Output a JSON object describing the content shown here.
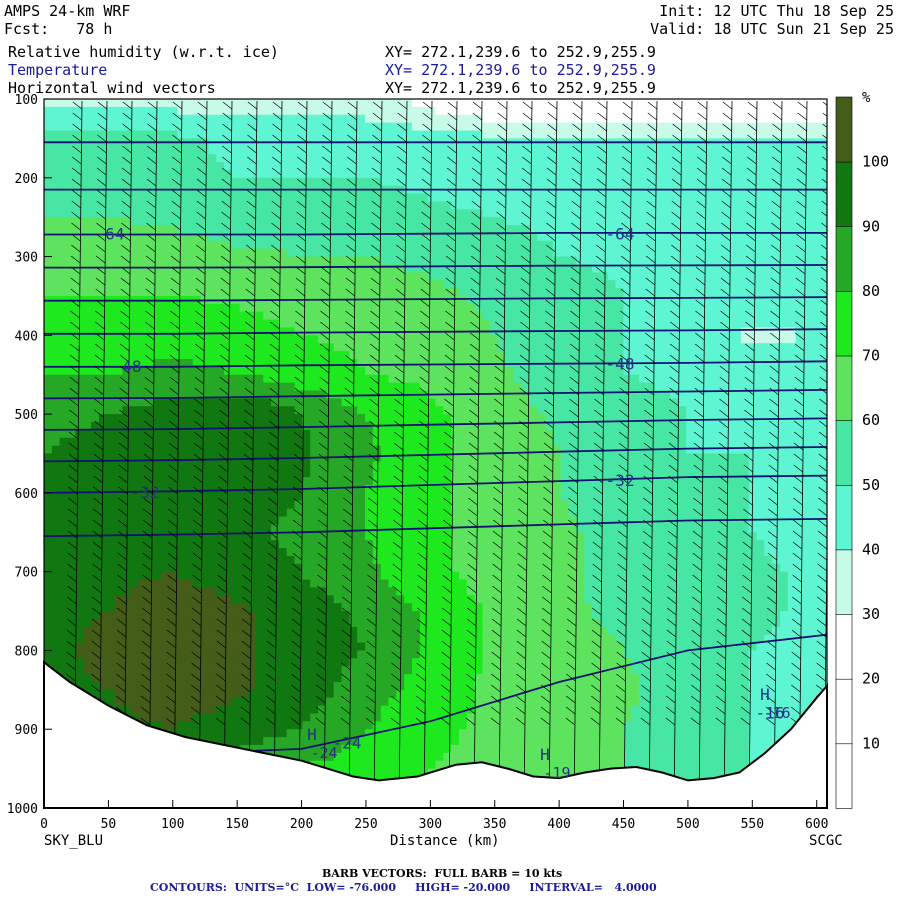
{
  "header": {
    "model": "AMPS 24-km WRF",
    "fcst": "Fcst:   78 h",
    "init": "Init: 12 UTC Thu 18 Sep 25",
    "valid": "Valid: 18 UTC Sun 21 Sep 25",
    "field1": "Relative humidity (w.r.t. ice)",
    "field2": "Temperature",
    "field3": "Horizontal wind vectors",
    "xy1": "XY= 272.1,239.6 to 252.9,255.9",
    "xy2": "XY= 272.1,239.6 to 252.9,255.9",
    "xy3": "XY= 272.1,239.6 to 252.9,255.9"
  },
  "axes": {
    "xlabel": "Distance (km)",
    "left_end": "SKY_BLU",
    "right_end": "SCGC",
    "colorbar_unit": "%"
  },
  "footer": {
    "barb": "BARB VECTORS:  FULL BARB = 10 kts",
    "contours": "CONTOURS:  UNITS=°C  LOW= -76.000     HIGH= -20.000     INTERVAL=   4.0000"
  },
  "colors": {
    "rh_0_10": "#ffffff",
    "rh_10_20": "#ffffff",
    "rh_20_30": "#ffffff",
    "rh_30_40": "#c8fae8",
    "rh_40_50": "#5ef5d2",
    "rh_50_60": "#47e6a4",
    "rh_60_70": "#5ee35e",
    "rh_70_80": "#1ee91e",
    "rh_80_90": "#26a826",
    "rh_90_100": "#117811",
    "rh_100": "#445d19",
    "contour": "#101075"
  },
  "chart_data": {
    "type": "heatmap",
    "xlabel": "Distance (km)",
    "ylabel": "",
    "x_ticks": [
      "0",
      "50",
      "100",
      "150",
      "200",
      "250",
      "300",
      "350",
      "400",
      "450",
      "500",
      "550",
      "600"
    ],
    "xlim": [
      0,
      608
    ],
    "y_ticks": [
      "100",
      "200",
      "300",
      "400",
      "500",
      "600",
      "700",
      "800",
      "900",
      "1000"
    ],
    "ylim": [
      1000,
      100
    ],
    "colorbar": {
      "unit": "%",
      "levels": [
        "10",
        "20",
        "30",
        "40",
        "50",
        "60",
        "70",
        "80",
        "90",
        "100"
      ],
      "bounds": [
        0,
        10,
        20,
        30,
        40,
        50,
        60,
        70,
        80,
        90,
        100,
        110
      ]
    },
    "rh_field": {
      "x": [
        0,
        50,
        100,
        150,
        200,
        250,
        300,
        350,
        400,
        450,
        500,
        550,
        600
      ],
      "pressure": [
        100,
        150,
        200,
        250,
        300,
        350,
        400,
        450,
        500,
        550,
        600,
        650,
        700,
        750,
        800,
        850,
        900,
        950
      ],
      "values": [
        [
          35,
          35,
          35,
          35,
          35,
          35,
          25,
          15,
          15,
          15,
          15,
          15,
          15
        ],
        [
          52,
          52,
          52,
          48,
          45,
          45,
          45,
          42,
          42,
          42,
          42,
          40,
          40
        ],
        [
          55,
          55,
          52,
          50,
          50,
          50,
          48,
          45,
          45,
          45,
          45,
          45,
          45
        ],
        [
          60,
          60,
          58,
          55,
          55,
          55,
          52,
          50,
          48,
          48,
          48,
          48,
          48
        ],
        [
          65,
          65,
          65,
          62,
          60,
          60,
          58,
          55,
          50,
          48,
          48,
          45,
          45
        ],
        [
          70,
          70,
          70,
          68,
          65,
          65,
          62,
          58,
          55,
          50,
          45,
          45,
          45
        ],
        [
          75,
          75,
          78,
          75,
          70,
          68,
          65,
          60,
          55,
          50,
          45,
          38,
          40
        ],
        [
          80,
          80,
          82,
          80,
          75,
          70,
          68,
          62,
          55,
          50,
          48,
          45,
          45
        ],
        [
          85,
          90,
          95,
          100,
          90,
          80,
          72,
          65,
          58,
          55,
          50,
          48,
          45
        ],
        [
          90,
          95,
          98,
          100,
          92,
          82,
          72,
          66,
          60,
          55,
          50,
          50,
          45
        ],
        [
          90,
          95,
          98,
          95,
          90,
          80,
          72,
          66,
          60,
          55,
          50,
          50,
          45
        ],
        [
          90,
          95,
          95,
          92,
          88,
          80,
          72,
          66,
          62,
          56,
          52,
          50,
          45
        ],
        [
          92,
          98,
          100,
          95,
          90,
          82,
          72,
          66,
          62,
          56,
          55,
          52,
          48
        ],
        [
          95,
          100,
          105,
          102,
          95,
          88,
          78,
          68,
          62,
          58,
          55,
          52,
          48
        ],
        [
          95,
          105,
          105,
          102,
          95,
          90,
          78,
          68,
          64,
          60,
          55,
          50,
          48
        ],
        [
          95,
          100,
          105,
          102,
          95,
          85,
          75,
          68,
          68,
          62,
          55,
          50,
          48
        ],
        [
          95,
          98,
          100,
          95,
          90,
          80,
          72,
          68,
          65,
          60,
          55,
          50,
          48
        ],
        [
          90,
          92,
          90,
          85,
          80,
          75,
          70,
          68,
          65,
          60,
          55,
          50,
          45
        ]
      ]
    },
    "terrain": {
      "x": [
        0,
        20,
        50,
        80,
        110,
        140,
        170,
        200,
        220,
        240,
        260,
        290,
        320,
        340,
        360,
        380,
        400,
        420,
        440,
        460,
        480,
        500,
        520,
        540,
        560,
        580,
        600,
        608
      ],
      "pressure": [
        815,
        840,
        870,
        895,
        910,
        920,
        930,
        940,
        950,
        960,
        965,
        960,
        945,
        942,
        950,
        960,
        962,
        955,
        950,
        948,
        955,
        965,
        962,
        955,
        930,
        900,
        860,
        845
      ]
    },
    "temperature_contours": [
      {
        "level": "-64",
        "x": [
          0,
          100,
          200,
          300,
          400,
          500,
          608
        ],
        "pressure": [
          272,
          272,
          272,
          271,
          270,
          270,
          270
        ]
      },
      {
        "level": "-48",
        "x": [
          0,
          100,
          200,
          300,
          400,
          500,
          608
        ],
        "pressure": [
          440,
          440,
          438,
          437,
          436,
          435,
          433
        ]
      },
      {
        "level": "-32",
        "x": [
          0,
          100,
          200,
          300,
          400,
          500,
          608
        ],
        "pressure": [
          600,
          598,
          595,
          590,
          585,
          580,
          578
        ]
      },
      {
        "level": "-24",
        "x": [
          120,
          200,
          300,
          400,
          500,
          608
        ],
        "pressure": [
          930,
          925,
          890,
          840,
          800,
          780
        ]
      }
    ],
    "contour_labels": [
      "-64",
      "-64",
      "-48",
      "-48",
      "-32",
      "-32",
      "-24",
      "-16"
    ],
    "high_markers": [
      {
        "label": "H",
        "value": "-24"
      },
      {
        "label": "H",
        "value": "-19"
      },
      {
        "label": "H",
        "value": "-16"
      }
    ]
  }
}
